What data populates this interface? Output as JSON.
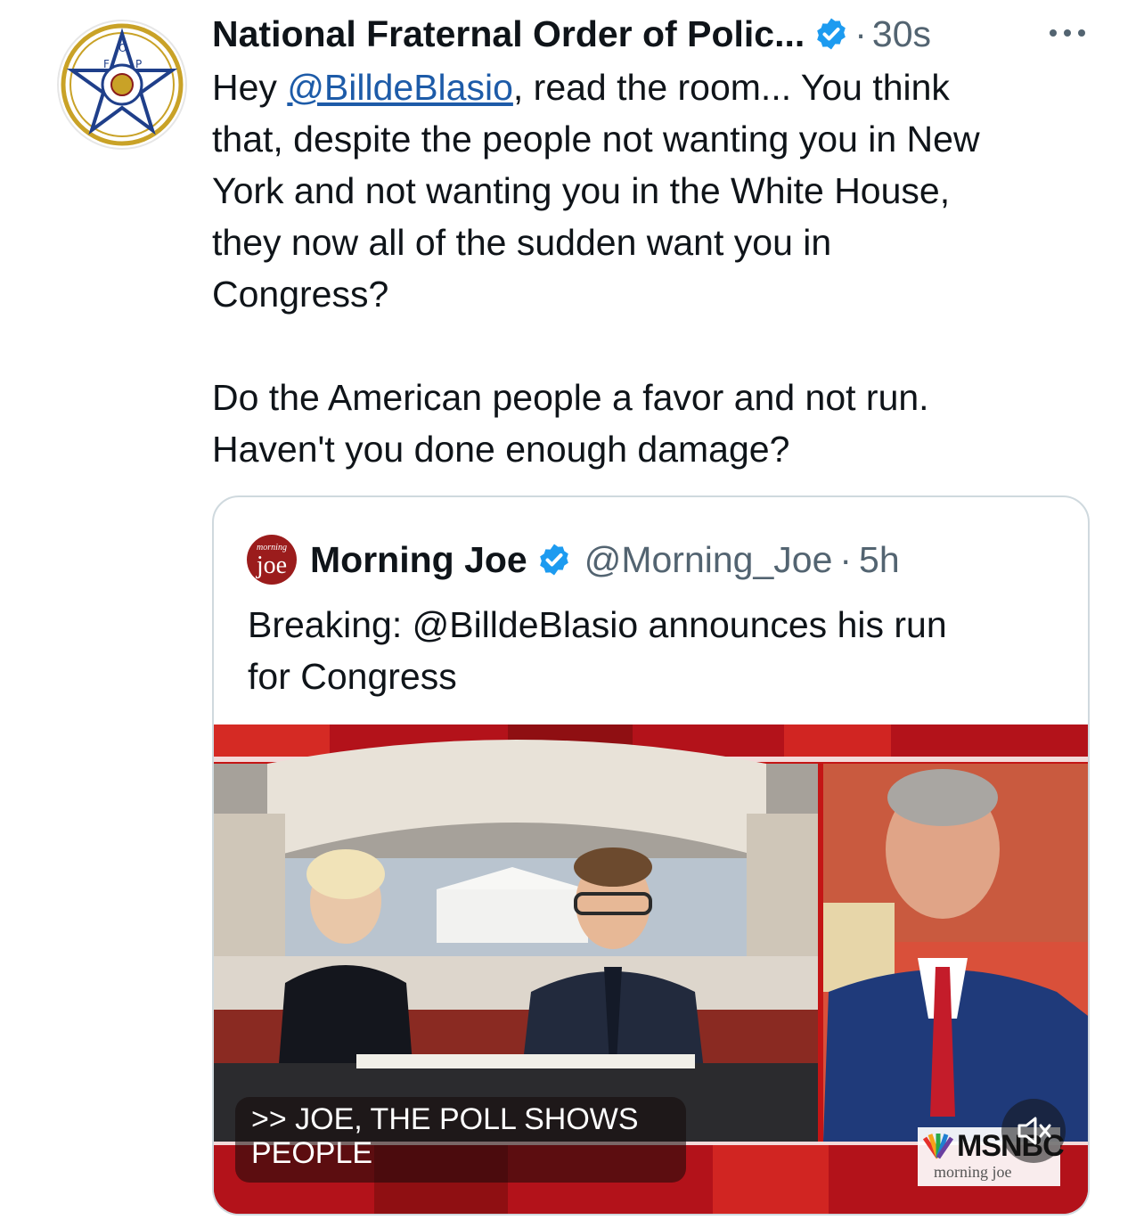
{
  "tweet": {
    "author_name": "National Fraternal Order of Polic...",
    "separator": "·",
    "time": "30s",
    "text_prefix": "Hey ",
    "mention": "@BilldeBlasio",
    "text_body": ", read the room... You think\nthat, despite the people not wanting you in New\nYork and not wanting you in the White House,\nthey now all of the sudden want you in\nCongress?\n\nDo the American people a favor and not run.\nHaven't you done enough damage?",
    "avatar_letters": [
      "F",
      "O",
      "P"
    ]
  },
  "quote": {
    "logo_small": "morning",
    "logo_big": "joe",
    "name": "Morning Joe",
    "handle": "@Morning_Joe",
    "separator": "·",
    "time": "5h",
    "text": "Breaking: @BilldeBlasio announces his run\nfor Congress"
  },
  "video": {
    "caption": ">> JOE, THE POLL SHOWS\nPEOPLE",
    "network": "MSNBC",
    "show": "morning joe"
  },
  "colors": {
    "verified": "#1d9bf0",
    "link": "#1d5ba8",
    "secondary_text": "#536471",
    "studio_red": "#c41515"
  },
  "icons": [
    "verified-badge-icon",
    "more-options-icon",
    "mute-icon",
    "peacock-icon"
  ]
}
